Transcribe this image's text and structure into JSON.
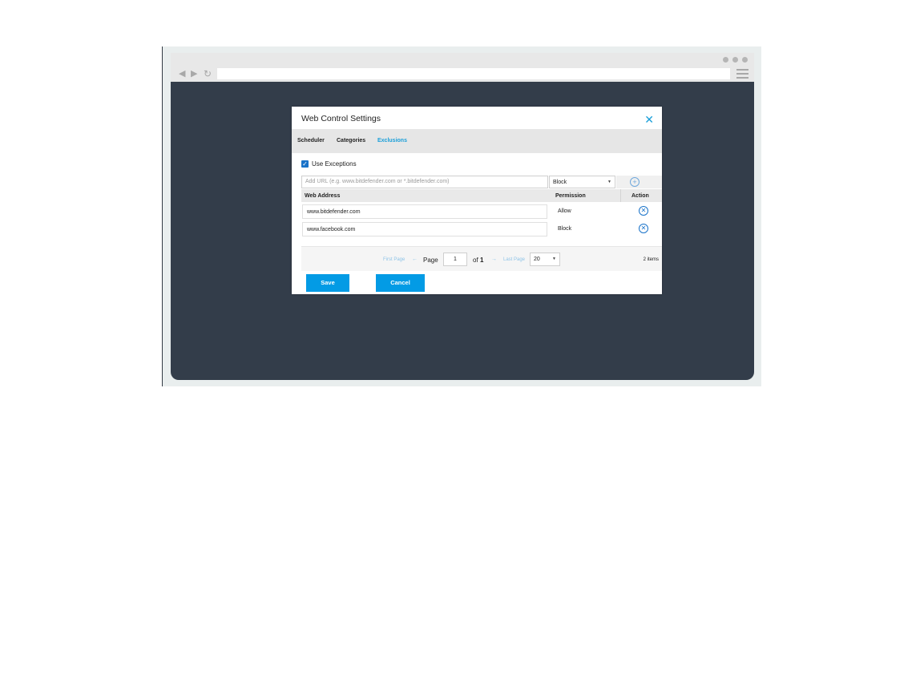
{
  "browser": {
    "back_icon": "◀",
    "forward_icon": "▶",
    "reload_icon": "↻"
  },
  "dialog": {
    "title": "Web Control Settings",
    "close_icon": "✕",
    "tabs": [
      {
        "label": "Scheduler",
        "active": false
      },
      {
        "label": "Categories",
        "active": false
      },
      {
        "label": "Exclusions",
        "active": true
      }
    ],
    "use_exceptions": {
      "label": "Use Exceptions",
      "checked": true,
      "check_icon": "✓"
    },
    "url_input": {
      "placeholder": "Add URL (e.g. www.bitdefender.com or *.bitdefender.com)",
      "value": ""
    },
    "permission_select": {
      "selected": "Block",
      "caret": "▼"
    },
    "add_icon": "+",
    "table": {
      "headers": {
        "address": "Web Address",
        "permission": "Permission",
        "action": "Action"
      },
      "rows": [
        {
          "address": "www.bitdefender.com",
          "permission": "Allow"
        },
        {
          "address": "www.facebook.com",
          "permission": "Block"
        }
      ],
      "remove_icon": "✕"
    },
    "pagination": {
      "first_page": "First Page",
      "prev_arrow": "←",
      "page_label": "Page",
      "current_page": "1",
      "of_label": "of",
      "total_pages": "1",
      "next_arrow": "→",
      "last_page": "Last Page",
      "per_page": "20",
      "caret": "▼",
      "items_count": "2 items"
    },
    "save_label": "Save",
    "cancel_label": "Cancel"
  },
  "colors": {
    "accent": "#039be5",
    "link": "#1a9fd9",
    "backdrop": "#333d4a"
  }
}
